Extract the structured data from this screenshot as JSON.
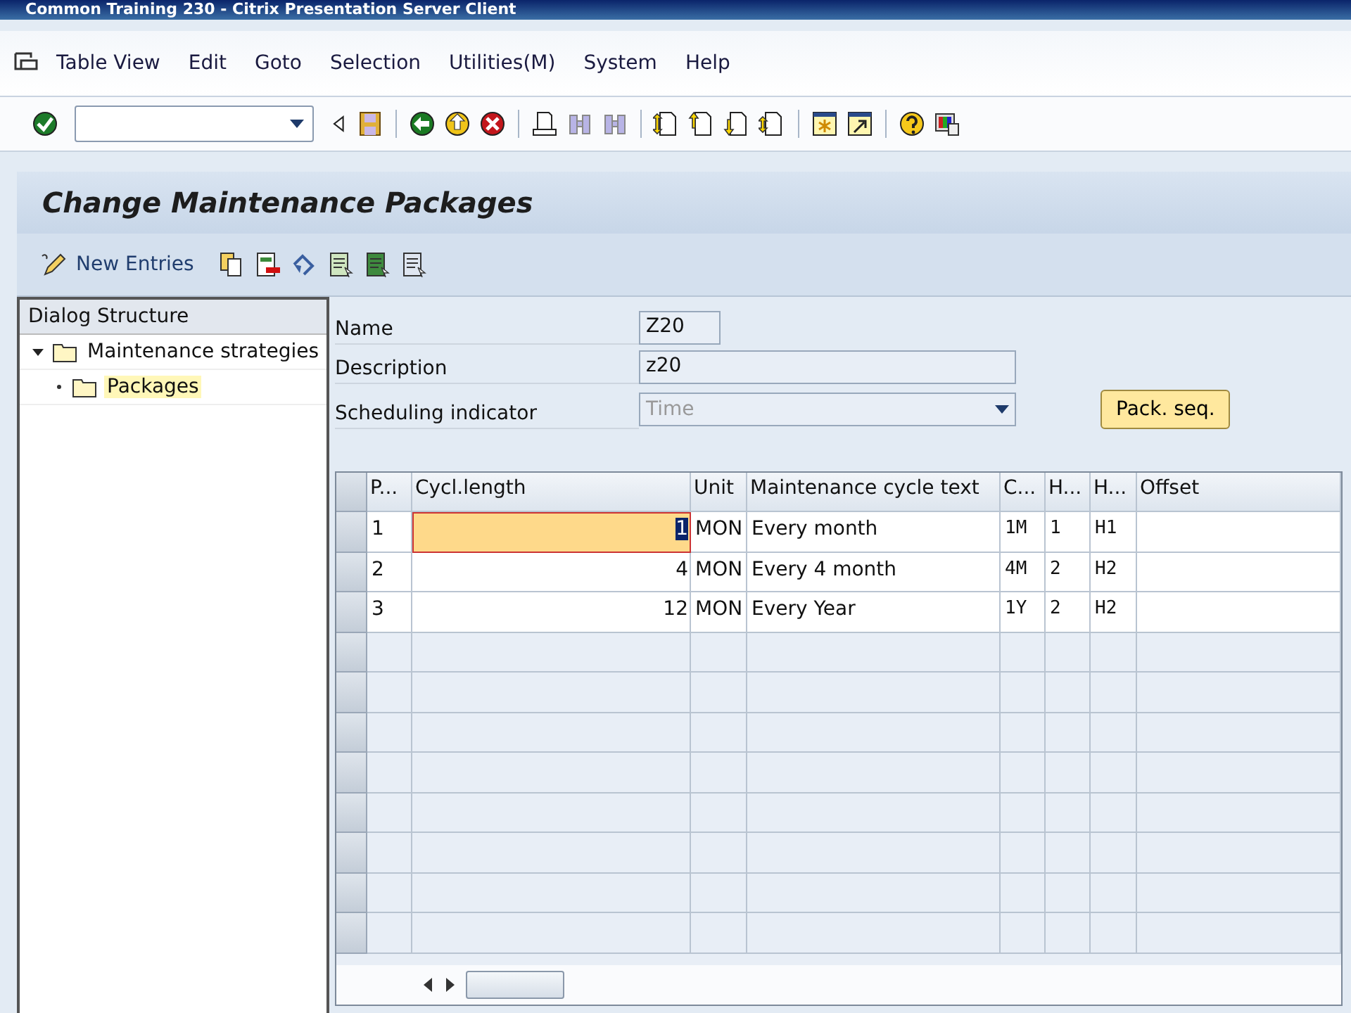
{
  "window": {
    "title": "Common Training 230 - Citrix Presentation Server Client"
  },
  "menu": [
    "Table View",
    "Edit",
    "Goto",
    "Selection",
    "Utilities(M)",
    "System",
    "Help"
  ],
  "screen_title": "Change Maintenance Packages",
  "app_toolbar": {
    "new_entries": "New Entries"
  },
  "dialog_structure": {
    "title": "Dialog Structure",
    "items": [
      {
        "label": "Maintenance strategies",
        "expanded": true,
        "selected": false,
        "children": [
          {
            "label": "Packages",
            "selected": true
          }
        ]
      }
    ]
  },
  "form": {
    "fields": [
      {
        "label": "Name",
        "value": "Z20",
        "kind": "short"
      },
      {
        "label": "Description",
        "value": "z20",
        "kind": "text"
      },
      {
        "label": "Scheduling indicator",
        "value": "Time",
        "kind": "dropdown",
        "disabled": true
      }
    ],
    "button": "Pack. seq."
  },
  "table": {
    "columns": [
      "P...",
      "Cycl.length",
      "Unit",
      "Maintenance cycle text",
      "C...",
      "H...",
      "H...",
      "Offset"
    ],
    "rows": [
      {
        "cells": [
          "1",
          "1",
          "MON",
          "Every month",
          "1M",
          "1",
          "H1"
        ],
        "focused": true
      },
      {
        "cells": [
          "2",
          "4",
          "MON",
          "Every 4 month",
          "4M",
          "2",
          "H2"
        ],
        "focused": false
      },
      {
        "cells": [
          "3",
          "12",
          "MON",
          "Every Year",
          "1Y",
          "2",
          "H2"
        ],
        "focused": false
      }
    ]
  }
}
